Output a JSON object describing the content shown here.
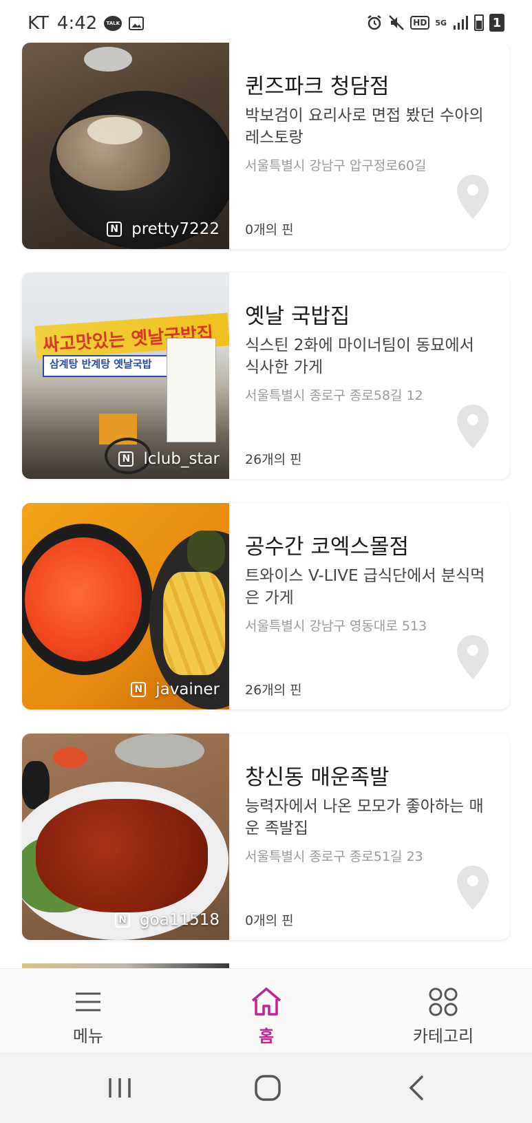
{
  "status_bar": {
    "carrier": "KT",
    "time": "4:42",
    "talk_label": "TALK",
    "hd_label": "HD",
    "network_label": "5G",
    "sim_number": "1"
  },
  "places": [
    {
      "name": "퀸즈파크 청담점",
      "description": "박보검이 요리사로 면접 봤던 수아의 레스토랑",
      "address": "서울특별시 강남구 압구정로60길",
      "pins": "0개의 핀",
      "photo_credit": "pretty7222"
    },
    {
      "name": "옛날 국밥집",
      "description": "식스틴 2화에 마이너팀이 동묘에서 식사한 가게",
      "address": "서울특별시 종로구 종로58길 12",
      "pins": "26개의 핀",
      "photo_credit": "lclub_star",
      "photo_sign_text": "싸고맛있는 옛날국밥집",
      "photo_sub_sign": "삼계탕  반계탕  옛날국밥"
    },
    {
      "name": "공수간 코엑스몰점",
      "description": "트와이스 V-LIVE 급식단에서 분식먹은 가게",
      "address": "서울특별시 강남구 영동대로 513",
      "pins": "26개의 핀",
      "photo_credit": "javainer"
    },
    {
      "name": "창신동 매운족발",
      "description": "능력자에서 나온 모모가 좋아하는 매운 족발집",
      "address": "서울특별시 종로구 종로51길 23",
      "pins": "0개의 핀",
      "photo_credit": "goa11518"
    }
  ],
  "icons": {
    "pin": "map-pin-icon",
    "photo_source": "naver-n-icon"
  },
  "bottom_nav": {
    "menu": "메뉴",
    "home": "홈",
    "category": "카테고리",
    "active": "home"
  },
  "colors": {
    "accent": "#c42192",
    "pin": "#e4e4e4"
  }
}
